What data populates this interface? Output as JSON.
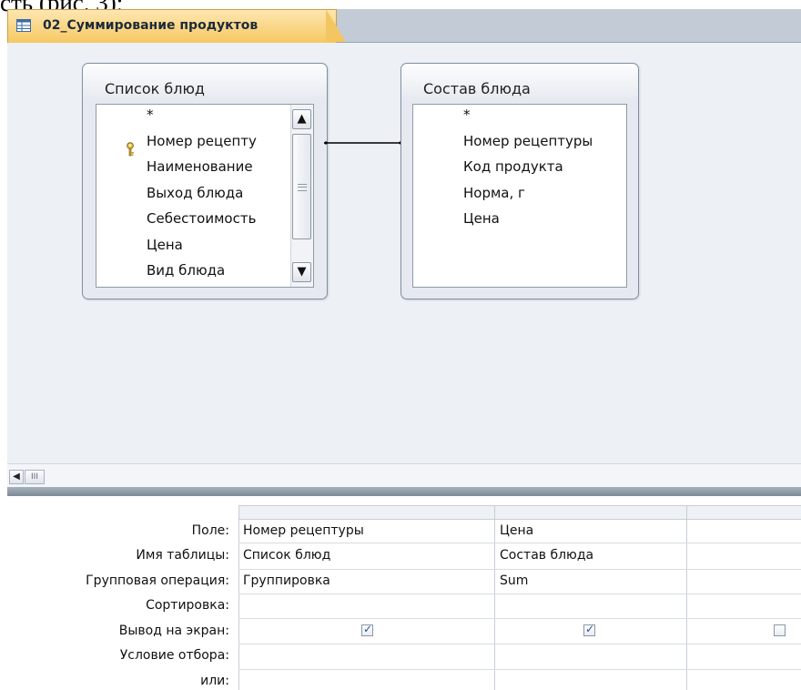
{
  "caption_fragment": "сть (рис. 3);",
  "tab": {
    "title": "02_Суммирование продуктов"
  },
  "tables": [
    {
      "title": "Список блюд",
      "fields": [
        "*",
        "Номер рецепту",
        "Наименование",
        "Выход блюда",
        "Себестоимость",
        "Цена",
        "Вид блюда"
      ],
      "key_field": "Номер рецепту",
      "scroll_up": "▲",
      "scroll_down": "▼"
    },
    {
      "title": "Состав блюда",
      "fields": [
        "*",
        "Номер рецептуры",
        "Код продукта",
        "Норма, г",
        "Цена"
      ]
    }
  ],
  "hscroll": {
    "left_arrow": "◀",
    "thumb": "III"
  },
  "grid": {
    "row_labels": [
      "Поле:",
      "Имя таблицы:",
      "Групповая операция:",
      "Сортировка:",
      "Вывод на экран:",
      "Условие отбора:",
      "или:"
    ],
    "columns": [
      {
        "field": "Номер рецептуры",
        "table": "Список блюд",
        "group": "Группировка",
        "sort": "",
        "show": true
      },
      {
        "field": "Цена",
        "table": "Состав блюда",
        "group": "Sum",
        "sort": "",
        "show": true
      },
      {
        "field": "",
        "table": "",
        "group": "",
        "sort": "",
        "show": false
      }
    ],
    "check_mark": "✓"
  }
}
